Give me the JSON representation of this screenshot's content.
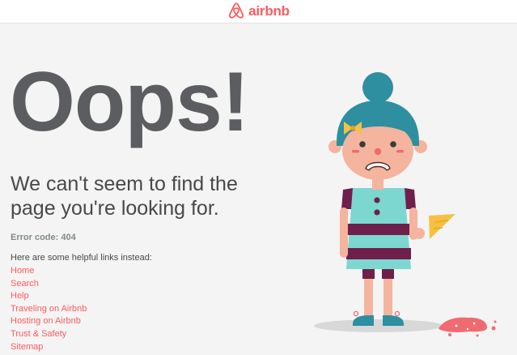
{
  "header": {
    "logo_text": "airbnb"
  },
  "main": {
    "headline": "Oops!",
    "subtitle": "We can't seem to find the page you're looking for.",
    "error_code": "Error code: 404",
    "links_intro": "Here are some helpful links instead:",
    "links": [
      "Home",
      "Search",
      "Help",
      "Traveling on Airbnb",
      "Hosting on Airbnb",
      "Trust & Safety",
      "Sitemap"
    ]
  },
  "colors": {
    "brand": "#ff5a5f",
    "headline": "#5b5d60",
    "background": "#f4f4f4"
  },
  "icons": {
    "logo": "airbnb-belo-icon",
    "illustration": "sad-girl-dropped-ice-cream-illustration"
  }
}
